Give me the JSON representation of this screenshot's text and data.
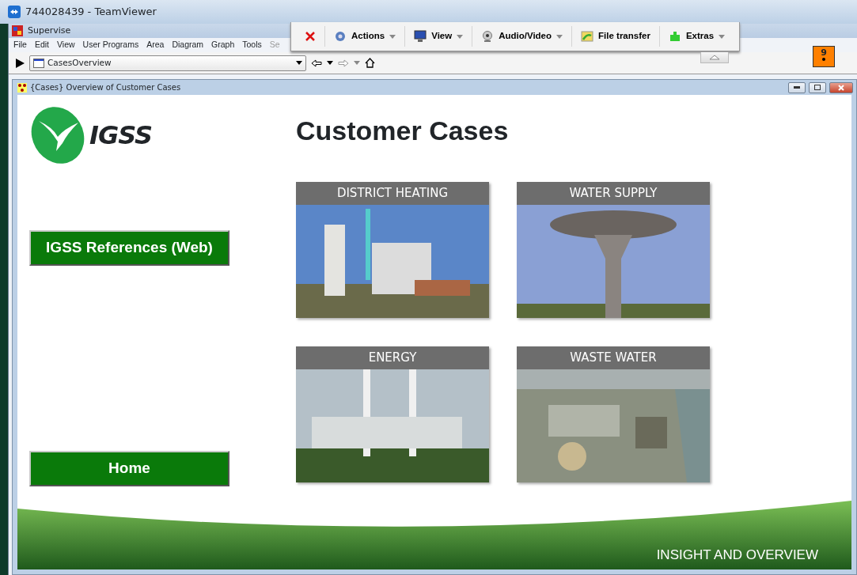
{
  "window": {
    "title": "744028439 - TeamViewer"
  },
  "app": {
    "title": "Supervise",
    "menu": [
      "File",
      "Edit",
      "View",
      "User Programs",
      "Area",
      "Diagram",
      "Graph",
      "Tools",
      "Se"
    ],
    "diagram_select": {
      "value": "CasesOverview"
    }
  },
  "remote_toolbar": {
    "items": [
      {
        "kind": "close"
      },
      {
        "kind": "menu",
        "label": "Actions",
        "has_menu": true
      },
      {
        "kind": "menu",
        "label": "View",
        "has_menu": true
      },
      {
        "kind": "menu",
        "label": "Audio/Video",
        "has_menu": true
      },
      {
        "kind": "menu",
        "label": "File transfer",
        "has_menu": false
      },
      {
        "kind": "menu",
        "label": "Extras",
        "has_menu": true
      }
    ]
  },
  "alarm_badge": {
    "text": "9"
  },
  "diagram_window": {
    "title": "{Cases} Overview of Customer Cases",
    "logo_text": "IGSS",
    "heading": "Customer Cases",
    "buttons": [
      "IGSS References (Web)",
      "Home"
    ],
    "cases": [
      {
        "title": "DISTRICT HEATING"
      },
      {
        "title": "WATER SUPPLY"
      },
      {
        "title": "ENERGY"
      },
      {
        "title": "WASTE WATER"
      }
    ],
    "footer": "INSIGHT AND OVERVIEW"
  }
}
